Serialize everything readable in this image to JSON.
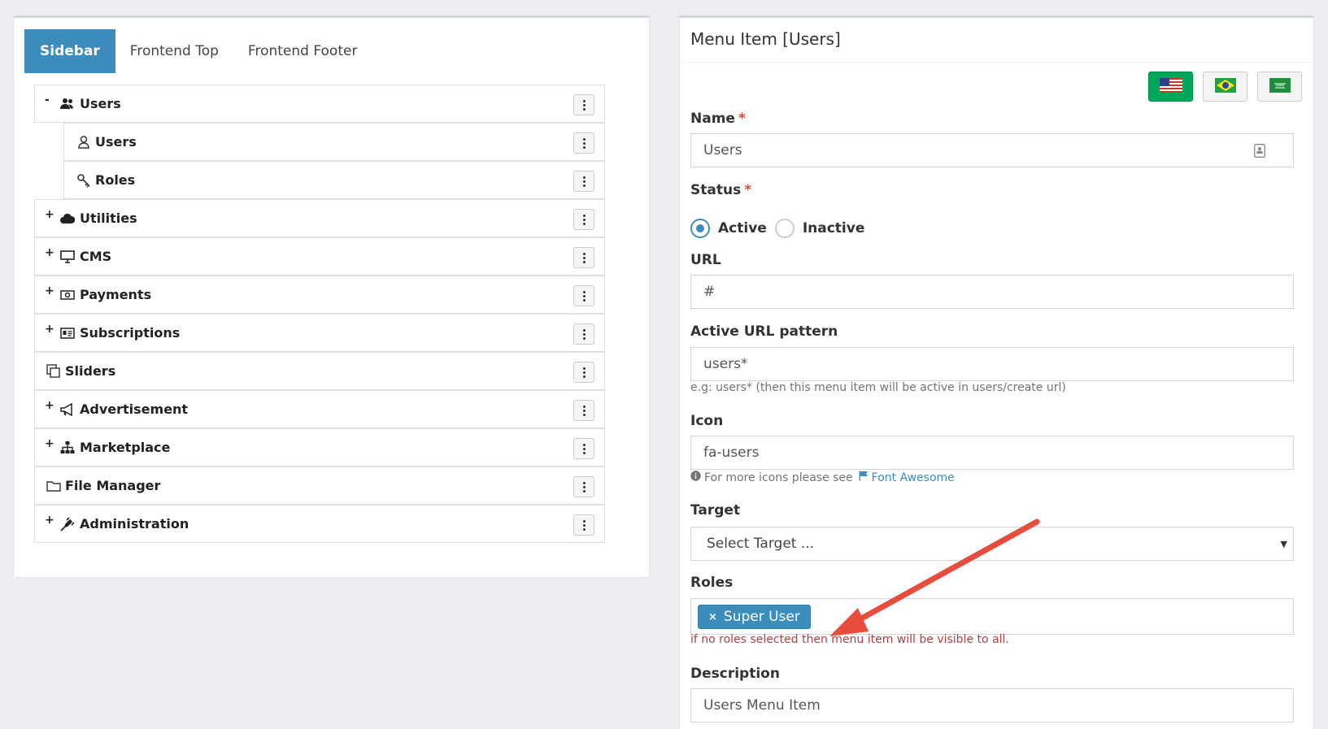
{
  "tabs": [
    {
      "label": "Sidebar",
      "active": true
    },
    {
      "label": "Frontend Top",
      "active": false
    },
    {
      "label": "Frontend Footer",
      "active": false
    }
  ],
  "menu": {
    "items": [
      {
        "label": "Users",
        "toggle": "-",
        "icon": "users-icon"
      },
      {
        "label": "Users",
        "toggle": "",
        "icon": "user-icon"
      },
      {
        "label": "Roles",
        "toggle": "",
        "icon": "key-icon"
      },
      {
        "label": "Utilities",
        "toggle": "+",
        "icon": "cloud-icon"
      },
      {
        "label": "CMS",
        "toggle": "+",
        "icon": "desktop-icon"
      },
      {
        "label": "Payments",
        "toggle": "+",
        "icon": "money-icon"
      },
      {
        "label": "Subscriptions",
        "toggle": "+",
        "icon": "id-card-icon"
      },
      {
        "label": "Sliders",
        "toggle": "",
        "icon": "clone-icon"
      },
      {
        "label": "Advertisement",
        "toggle": "+",
        "icon": "bullhorn-icon"
      },
      {
        "label": "Marketplace",
        "toggle": "+",
        "icon": "sitemap-icon"
      },
      {
        "label": "File Manager",
        "toggle": "",
        "icon": "folder-icon"
      },
      {
        "label": "Administration",
        "toggle": "+",
        "icon": "plug-icon"
      }
    ]
  },
  "form": {
    "title": "Menu Item [Users]",
    "languages": [
      {
        "icon": "us-flag-icon",
        "active": true
      },
      {
        "icon": "brazil-flag-icon",
        "active": false
      },
      {
        "icon": "saudi-flag-icon",
        "active": false
      }
    ],
    "name": {
      "label": "Name",
      "required": "*",
      "value": "Users"
    },
    "status": {
      "label": "Status",
      "required": "*",
      "active_label": "Active",
      "inactive_label": "Inactive",
      "selected": "Active"
    },
    "url": {
      "label": "URL",
      "value": "#"
    },
    "active_url_pattern": {
      "label": "Active URL pattern",
      "value": "users*",
      "help": "e.g: users* (then this menu item will be active in users/create url)"
    },
    "icon": {
      "label": "Icon",
      "value": "fa-users",
      "help_prefix": "For more icons please see",
      "help_link": "Font Awesome"
    },
    "target": {
      "label": "Target",
      "placeholder": "Select Target ..."
    },
    "roles": {
      "label": "Roles",
      "tags": [
        "Super User"
      ],
      "help": "if no roles selected then menu item will be visible to all."
    },
    "description": {
      "label": "Description",
      "value": "Users Menu Item"
    }
  },
  "colors": {
    "primary": "#3c8dbc",
    "success": "#00a65a",
    "danger": "#dd4b39",
    "arrow": "#e74c3c"
  }
}
